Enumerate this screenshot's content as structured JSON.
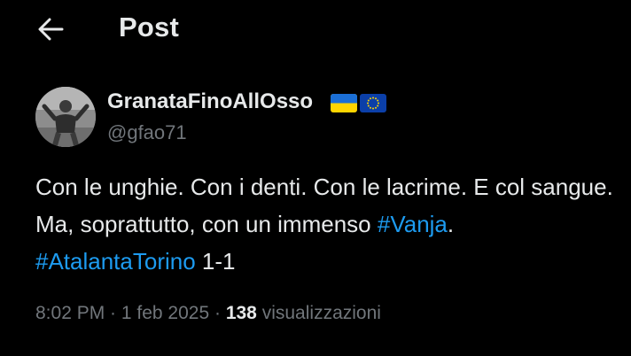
{
  "header": {
    "back_icon": "arrow-left-icon",
    "title": "Post"
  },
  "author": {
    "display_name": "GranataFinoAllOsso",
    "handle": "@gfao71",
    "avatar_icon": "avatar-photo",
    "flags": [
      "ukraine-flag-icon",
      "eu-flag-icon"
    ]
  },
  "tweet": {
    "line1": "Con le unghie. Con i denti. Con le lacrime. E col sangue.",
    "line2_text": "Ma, soprattutto, con un immenso ",
    "line2_hashtag": "#Vanja",
    "line2_end": ".",
    "line3_hashtag": "#AtalantaTorino",
    "line3_end": " 1-1"
  },
  "meta": {
    "time": "8:02 PM",
    "sep1": " · ",
    "date": "1 feb 2025",
    "sep2": " · ",
    "views_count": "138",
    "views_label": " visualizzazioni"
  },
  "colors": {
    "background": "#000000",
    "text": "#e7e9ea",
    "secondary": "#71767b",
    "accent": "#1d9bf0"
  }
}
